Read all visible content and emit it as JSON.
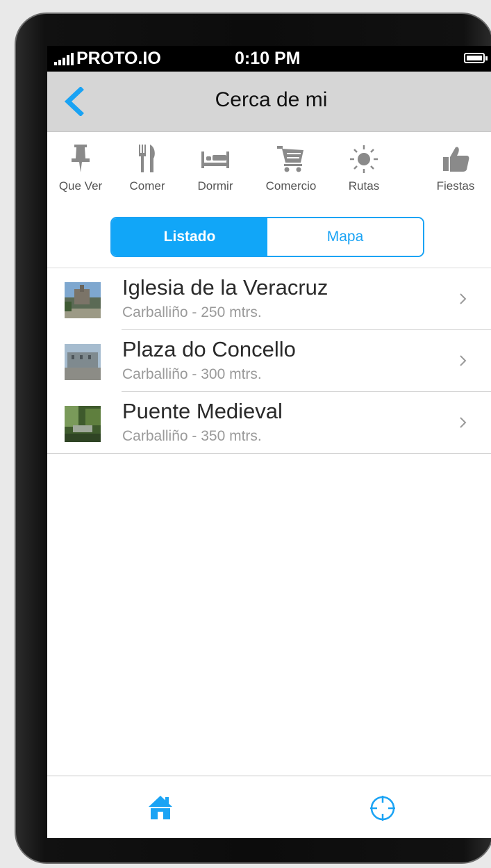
{
  "status_bar": {
    "carrier": "PROTO.IO",
    "time": "0:10 PM"
  },
  "nav": {
    "title": "Cerca de mi",
    "back_icon": "chevron-left-icon"
  },
  "categories": [
    {
      "label": "Que Ver",
      "icon": "pushpin-icon"
    },
    {
      "label": "Comer",
      "icon": "fork-knife-icon"
    },
    {
      "label": "Dormir",
      "icon": "bed-icon"
    },
    {
      "label": "Comercio",
      "icon": "shopping-cart-icon"
    },
    {
      "label": "Rutas",
      "icon": "sun-icon"
    },
    {
      "label": "Fiestas",
      "icon": "thumbs-up-icon"
    }
  ],
  "segment": {
    "selected": "Listado",
    "options": [
      "Listado",
      "Mapa"
    ]
  },
  "places": [
    {
      "title": "Iglesia de la Veracruz",
      "subtitle": "Carballiño - 250 mtrs."
    },
    {
      "title": "Plaza do Concello",
      "subtitle": "Carballiño - 300 mtrs."
    },
    {
      "title": "Puente Medieval",
      "subtitle": "Carballiño - 350 mtrs."
    }
  ],
  "tabbar": {
    "tabs": [
      {
        "icon": "home-icon"
      },
      {
        "icon": "crosshair-icon"
      }
    ]
  },
  "colors": {
    "accent": "#11a6f8",
    "navbar": "#d6d6d6",
    "icon_gray": "#8a8a8a"
  }
}
